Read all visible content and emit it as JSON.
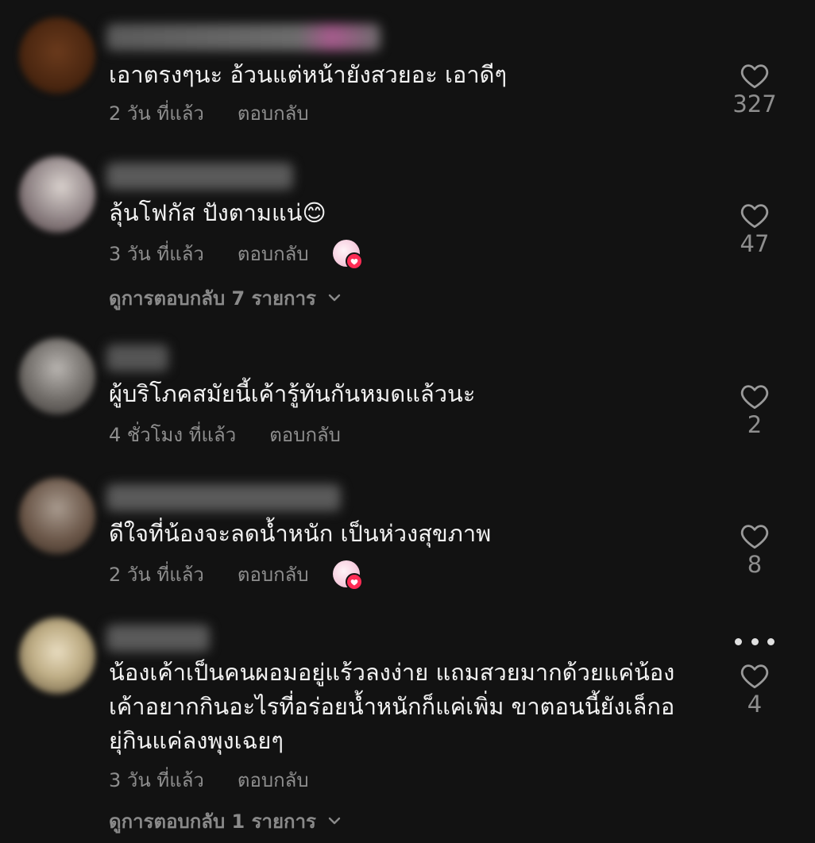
{
  "colors": {
    "background": "#121212",
    "text": "#f2f2f2",
    "meta": "#8e8e8e",
    "like_badge": "#fe2c55"
  },
  "comments": [
    {
      "text": "เอาตรงๆนะ อ้วนแต่หน้ายังสวยอะ เอาดีๆ",
      "time": "2 วัน ที่แล้ว",
      "reply": "ตอบกลับ",
      "likes": "327",
      "creator_liked": false,
      "view_replies": null
    },
    {
      "text": "ลุ้นโฟกัส ปังตามแน่😊",
      "time": "3 วัน ที่แล้ว",
      "reply": "ตอบกลับ",
      "likes": "47",
      "creator_liked": true,
      "view_replies": "ดูการตอบกลับ 7 รายการ"
    },
    {
      "text": "ผู้บริโภคสมัยนี้เค้ารู้ทันกันหมดแล้วนะ",
      "time": "4 ชั่วโมง ที่แล้ว",
      "reply": "ตอบกลับ",
      "likes": "2",
      "creator_liked": false,
      "view_replies": null
    },
    {
      "text": "ดีใจที่น้องจะลดน้ำหนัก เป็นห่วงสุขภาพ",
      "time": "2 วัน ที่แล้ว",
      "reply": "ตอบกลับ",
      "likes": "8",
      "creator_liked": true,
      "view_replies": null
    },
    {
      "text": "น้องเค้าเป็นคนผอมอยู่แร้วลงง่าย แถมสวยมากด้วยแค่น้อง\nเค้าอยากกินอะไรที่อร่อยน้ำหนักก็แค่เพิ่ม ขาตอนนี้ยังเล็กอ\nยุ่กินแค่ลงพุงเฉยๆ",
      "time": "3 วัน ที่แล้ว",
      "reply": "ตอบกลับ",
      "likes": "4",
      "creator_liked": false,
      "view_replies": "ดูการตอบกลับ 1 รายการ"
    }
  ],
  "icons": {
    "like": "heart-outline-icon",
    "more": "more-dots-icon",
    "expand": "chevron-down-icon",
    "creator_badge": "creator-liked-avatar-icon"
  }
}
